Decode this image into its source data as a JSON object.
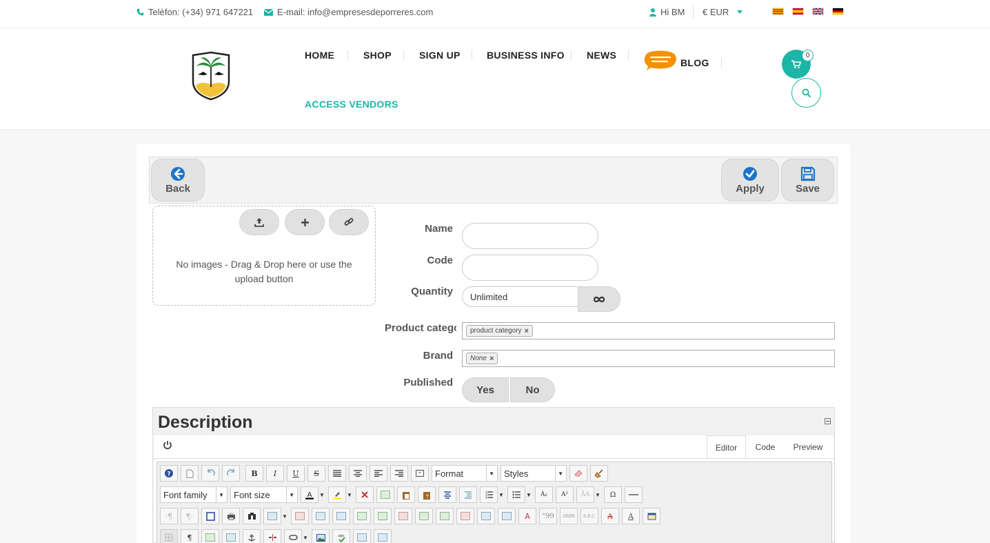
{
  "topbar": {
    "phone": "Telèfon: (+34) 971 647221",
    "email": "E-mail: info@empresesdeporreres.com",
    "greeting": "Hi BM",
    "currency": "€ EUR"
  },
  "nav": {
    "home": "HOME",
    "shop": "SHOP",
    "signup": "SIGN UP",
    "business_info": "BUSINESS INFO",
    "news": "NEWS",
    "blog": "BLOG",
    "access_vendors": "ACCESS VENDORS",
    "cart_count": "0"
  },
  "toolbar": {
    "back": "Back",
    "apply": "Apply",
    "save": "Save"
  },
  "images": {
    "hint": "No images - Drag & Drop here or use the upload button"
  },
  "form": {
    "name_label": "Name",
    "name_value": "",
    "code_label": "Code",
    "code_value": "",
    "quantity_label": "Quantity",
    "quantity_value": "Unlimited",
    "category_label": "Product category",
    "category_tag": "product category",
    "brand_label": "Brand",
    "brand_tag": "None",
    "published_label": "Published",
    "yes": "Yes",
    "no": "No"
  },
  "description": {
    "title": "Description",
    "tabs": [
      "Editor",
      "Code",
      "Preview"
    ],
    "format_label": "Format",
    "styles_label": "Styles",
    "font_family_label": "Font family",
    "font_size_label": "Font size"
  },
  "colors": {
    "accent": "#1cb5a6",
    "icon_blue": "#1a73c8"
  }
}
